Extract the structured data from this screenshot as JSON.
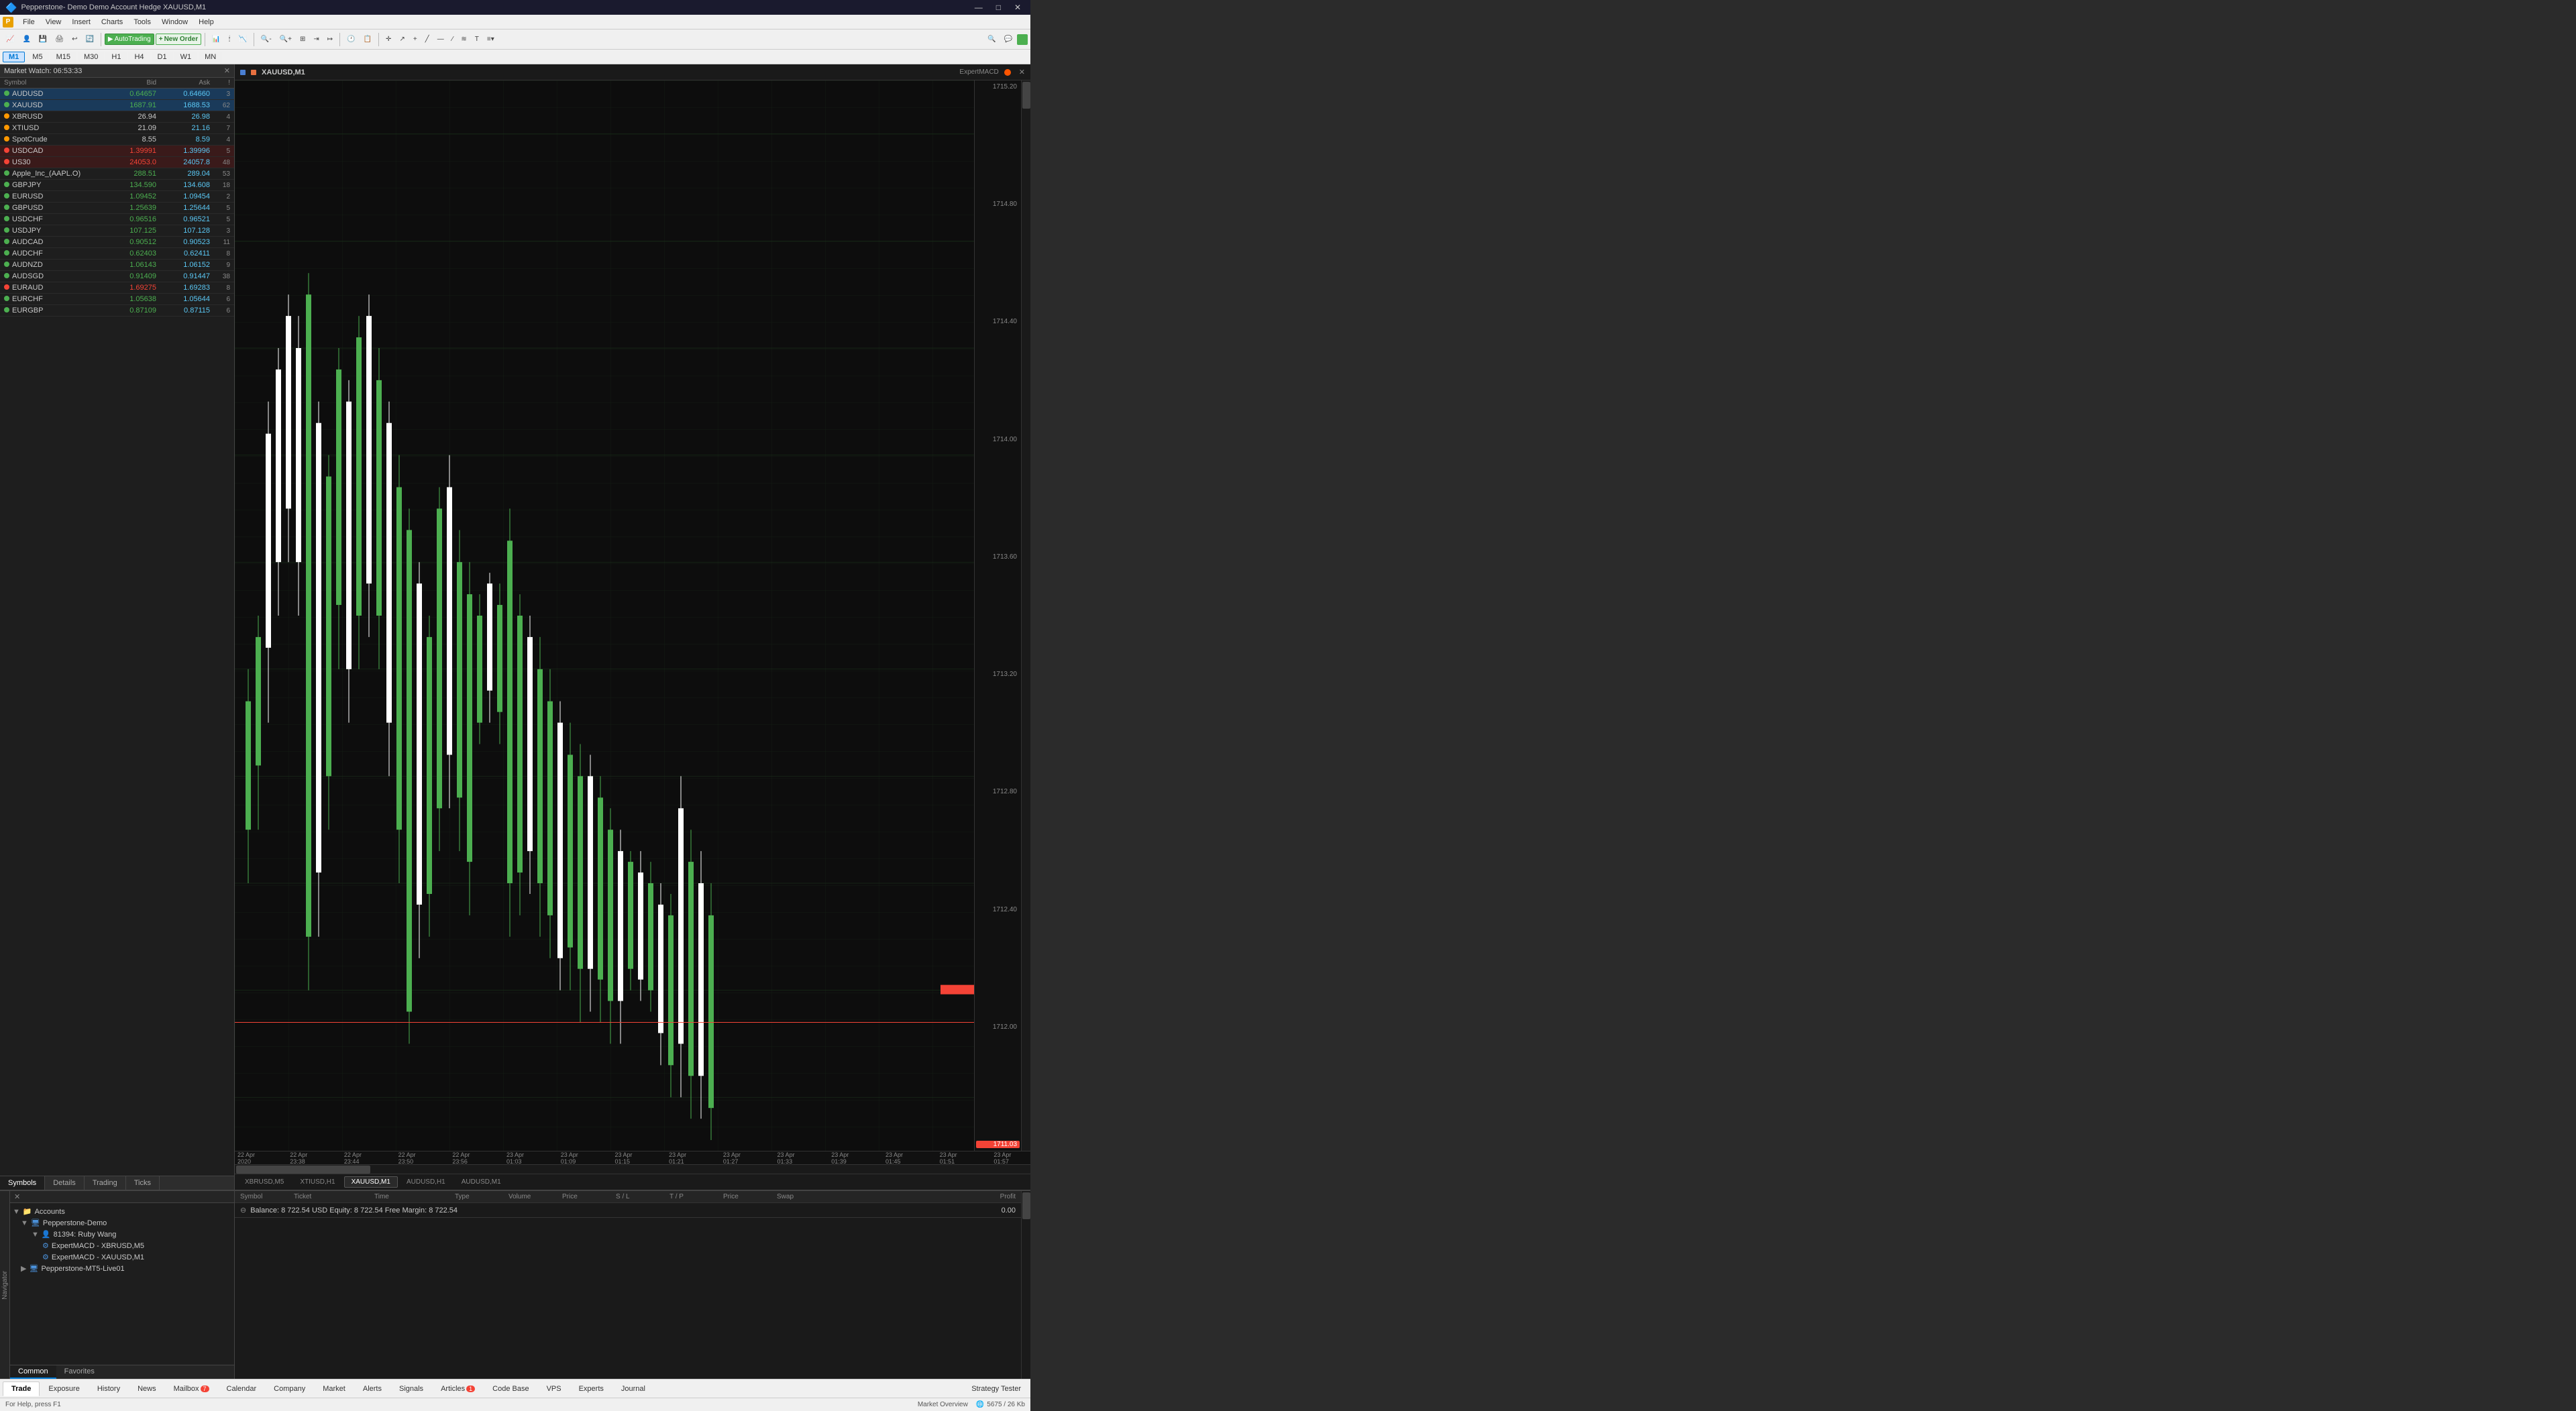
{
  "titlebar": {
    "title": "Pepperstone- Demo Demo Account  Hedge  XAUUSD,M1",
    "app_label": "8 & ■",
    "minimize": "—",
    "maximize": "□",
    "close": "✕"
  },
  "menubar": {
    "items": [
      "File",
      "View",
      "Insert",
      "Charts",
      "Tools",
      "Window",
      "Help"
    ]
  },
  "toolbar": {
    "autotrading": "AutoTrading",
    "new_order": "New Order"
  },
  "timeframes": {
    "items": [
      "M1",
      "M5",
      "M15",
      "M30",
      "H1",
      "H4",
      "D1",
      "W1",
      "MN"
    ],
    "active": "M1"
  },
  "market_watch": {
    "header": "Market Watch: 06:53:33",
    "columns": {
      "symbol": "Symbol",
      "bid": "Bid",
      "ask": "Ask",
      "spread": "!"
    },
    "symbols": [
      {
        "name": "AUDUSD",
        "bid": "0.64657",
        "ask": "0.64660",
        "spread": "3",
        "color": "green",
        "selected": true
      },
      {
        "name": "XAUUSD",
        "bid": "1687.91",
        "ask": "1688.53",
        "spread": "62",
        "color": "green",
        "selected": true
      },
      {
        "name": "XBRUSD",
        "bid": "26.94",
        "ask": "26.98",
        "spread": "4",
        "color": "orange"
      },
      {
        "name": "XTIUSD",
        "bid": "21.09",
        "ask": "21.16",
        "spread": "7",
        "color": "orange"
      },
      {
        "name": "SpotCrude",
        "bid": "8.55",
        "ask": "8.59",
        "spread": "4",
        "color": "orange"
      },
      {
        "name": "USDCAD",
        "bid": "1.39991",
        "ask": "1.39996",
        "spread": "5",
        "color": "red",
        "highlight": "red"
      },
      {
        "name": "US30",
        "bid": "24053.0",
        "ask": "24057.8",
        "spread": "48",
        "color": "red",
        "highlight": "red"
      },
      {
        "name": "Apple_Inc_(AAPL.O)",
        "bid": "288.51",
        "ask": "289.04",
        "spread": "53",
        "color": "green"
      },
      {
        "name": "GBPJPY",
        "bid": "134.590",
        "ask": "134.608",
        "spread": "18",
        "color": "green"
      },
      {
        "name": "EURUSD",
        "bid": "1.09452",
        "ask": "1.09454",
        "spread": "2",
        "color": "green"
      },
      {
        "name": "GBPUSD",
        "bid": "1.25639",
        "ask": "1.25644",
        "spread": "5",
        "color": "green"
      },
      {
        "name": "USDCHF",
        "bid": "0.96516",
        "ask": "0.96521",
        "spread": "5",
        "color": "green"
      },
      {
        "name": "USDJPY",
        "bid": "107.125",
        "ask": "107.128",
        "spread": "3",
        "color": "green"
      },
      {
        "name": "AUDCAD",
        "bid": "0.90512",
        "ask": "0.90523",
        "spread": "11",
        "color": "green"
      },
      {
        "name": "AUDCHF",
        "bid": "0.62403",
        "ask": "0.62411",
        "spread": "8",
        "color": "green"
      },
      {
        "name": "AUDNZD",
        "bid": "1.06143",
        "ask": "1.06152",
        "spread": "9",
        "color": "green"
      },
      {
        "name": "AUDSGD",
        "bid": "0.91409",
        "ask": "0.91447",
        "spread": "38",
        "color": "green"
      },
      {
        "name": "EURAUD",
        "bid": "1.69275",
        "ask": "1.69283",
        "spread": "8",
        "color": "red"
      },
      {
        "name": "EURCHF",
        "bid": "1.05638",
        "ask": "1.05644",
        "spread": "6",
        "color": "green"
      },
      {
        "name": "EURGBP",
        "bid": "0.87109",
        "ask": "0.87115",
        "spread": "6",
        "color": "green"
      }
    ]
  },
  "mw_tabs": [
    "Symbols",
    "Details",
    "Trading",
    "Ticks"
  ],
  "chart": {
    "symbol": "XAUUSD,M1",
    "expert": "ExpertMACD",
    "price_levels": [
      "1715.20",
      "1714.80",
      "1714.40",
      "1714.00",
      "1713.60",
      "1713.20",
      "1712.80",
      "1712.40",
      "1712.00"
    ],
    "current_price": "1711.03",
    "time_labels": [
      "22 Apr 2020",
      "22 Apr 23:38",
      "22 Apr 23:44",
      "22 Apr 23:50",
      "22 Apr 23:56",
      "23 Apr 01:03",
      "23 Apr 01:09",
      "23 Apr 01:15",
      "23 Apr 01:21",
      "23 Apr 01:27",
      "23 Apr 01:33",
      "23 Apr 01:39",
      "23 Apr 01:45",
      "23 Apr 01:51",
      "23 Apr 01:57"
    ],
    "tabs": [
      "XBRUSD,M5",
      "XTIUSD,H1",
      "XAUUSD,M1",
      "AUDUSD,H1",
      "AUDUSD,M1"
    ],
    "active_tab": "XAUUSD,M1"
  },
  "navigator": {
    "accounts": [
      {
        "name": "Accounts",
        "children": [
          {
            "name": "Pepperstone-Demo",
            "children": [
              {
                "name": "81394: Ruby Wang",
                "children": [
                  {
                    "name": "ExpertMACD - XBRUSD,M5"
                  },
                  {
                    "name": "ExpertMACD - XAUUSD,M1"
                  }
                ]
              }
            ]
          },
          {
            "name": "Pepperstone-MT5-Live01"
          }
        ]
      }
    ],
    "tabs": [
      "Common",
      "Favorites"
    ],
    "active_tab": "Common"
  },
  "trade": {
    "columns": [
      "Symbol",
      "Ticket",
      "Time",
      "Type",
      "Volume",
      "Price",
      "S / L",
      "T / P",
      "Price",
      "Swap",
      "Profit"
    ],
    "balance_text": "Balance: 8 722.54 USD  Equity: 8 722.54  Free Margin: 8 722.54",
    "profit_value": "0.00"
  },
  "bottom_tabs": {
    "items": [
      "Trade",
      "Exposure",
      "History",
      "News",
      "Mailbox",
      "Calendar",
      "Company",
      "Market",
      "Alerts",
      "Signals",
      "Articles",
      "Code Base",
      "VPS",
      "Experts",
      "Journal"
    ],
    "active": "Trade",
    "mailbox_badge": "7",
    "articles_badge": "1",
    "strategy_tester": "Strategy Tester"
  },
  "statusbar": {
    "help_text": "For Help, press F1",
    "market_overview": "Market Overview",
    "size_info": "5675 / 26 Kb"
  },
  "colors": {
    "bg_dark": "#0d0d0d",
    "bg_panel": "#1e1e1e",
    "bg_header": "#252525",
    "accent_blue": "#0078d4",
    "candle_bull": "#ffffff",
    "candle_bear": "#4caf50",
    "price_line": "#f44336",
    "grid": "#1a2a1a"
  }
}
